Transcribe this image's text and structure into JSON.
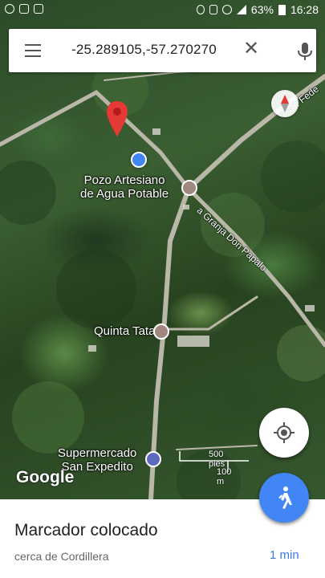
{
  "status_bar": {
    "battery": "63%",
    "time": "16:28"
  },
  "search": {
    "query": "-25.289105,-57.270270"
  },
  "map": {
    "places": [
      {
        "name": "Pozo Artesiano\nde Agua Potable"
      },
      {
        "name": "Quinta Tatano"
      },
      {
        "name": "Supermercado\nSan Expedito"
      }
    ],
    "roads": [
      {
        "name": "a Granja Don Papalo"
      },
      {
        "name": "Dr. Fede"
      }
    ],
    "scale_feet": "500 pies",
    "scale_meters": "100 m",
    "brand": "Google"
  },
  "sheet": {
    "title": "Marcador colocado",
    "subtitle": "cerca de Cordillera",
    "eta": "1 min"
  },
  "colors": {
    "accent": "#4285f4",
    "pin": "#e53935",
    "eta": "#3b78e7"
  }
}
